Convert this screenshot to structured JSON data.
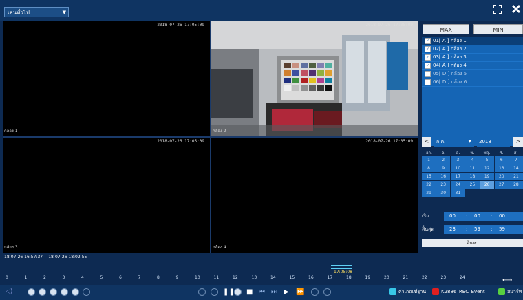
{
  "top": {
    "mode_select": "เล่นทั่วไป",
    "fullscreen_icon": "expand-icon",
    "close_icon": "close-icon"
  },
  "cells": [
    {
      "timestamp": "2018-07-26 17:05:09",
      "label": "กล้อง 1"
    },
    {
      "timestamp": "2018-07-26 17:05:09",
      "label": "กล้อง 2"
    },
    {
      "timestamp": "2018-07-26 17:05:09",
      "label": "กล้อง 3"
    },
    {
      "timestamp": "2018-07-26 17:05:09",
      "label": "กล้อง 4"
    }
  ],
  "right": {
    "max_label": "MAX",
    "min_label": "MIN",
    "cameras": [
      {
        "label": "01[ A ] กล้อง 1",
        "checked": true
      },
      {
        "label": "02[ A ] กล้อง 2",
        "checked": true
      },
      {
        "label": "03[ A ] กล้อง 3",
        "checked": true
      },
      {
        "label": "04[ A ] กล้อง 4",
        "checked": true
      },
      {
        "label": "05[ D ] กล้อง 5",
        "checked": false
      },
      {
        "label": "06[ D ] กล้อง 6",
        "checked": false
      }
    ],
    "calendar": {
      "prev": "<",
      "next": ">",
      "month": "ก.ค.",
      "year": "2018",
      "weekdays": [
        "อา.",
        "จ.",
        "อ.",
        "พ.",
        "พฤ.",
        "ศ.",
        "ส."
      ],
      "days": [
        "1",
        "2",
        "3",
        "4",
        "5",
        "6",
        "7",
        "8",
        "9",
        "10",
        "11",
        "12",
        "13",
        "14",
        "15",
        "16",
        "17",
        "18",
        "19",
        "20",
        "21",
        "22",
        "23",
        "24",
        "25",
        "26",
        "27",
        "28",
        "29",
        "30",
        "31"
      ],
      "today": "26"
    },
    "start_label": "เริ่ม",
    "start_time": [
      "00",
      "00",
      "00"
    ],
    "end_label": "สิ้นสุด",
    "end_time": [
      "23",
      "59",
      "59"
    ],
    "search_label": "ค้นหา"
  },
  "timeline": {
    "range": "18-07-26 16:57:37 -- 18-07-26 18:02:55",
    "cursor_time": "17:05:08",
    "ticks": [
      "0",
      "1",
      "2",
      "3",
      "4",
      "5",
      "6",
      "7",
      "8",
      "9",
      "10",
      "11",
      "12",
      "13",
      "14",
      "15",
      "16",
      "17",
      "18",
      "19",
      "20",
      "21",
      "22",
      "23",
      "24"
    ]
  },
  "legend": [
    {
      "label": "ค่าเกณฑ์ฐาน",
      "color": "#38c8e8"
    },
    {
      "label": "K2886_REC_Event",
      "color": "#e02020"
    },
    {
      "label": "สมาร์ท",
      "color": "#58d040"
    }
  ]
}
